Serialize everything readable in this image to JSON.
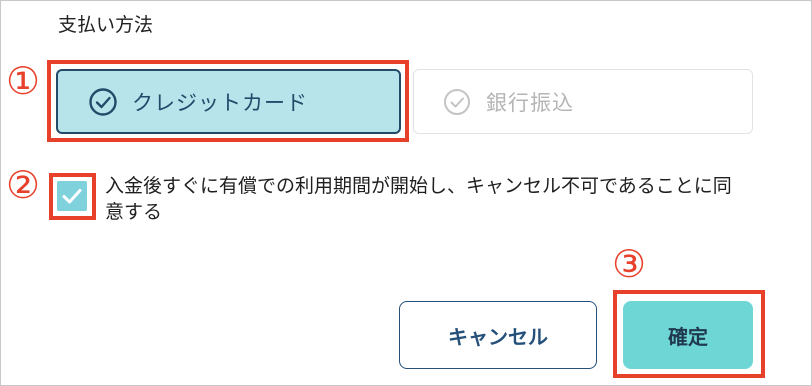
{
  "section_title": "支払い方法",
  "payment_options": [
    {
      "label": "クレジットカード",
      "icon": "check-circle-icon",
      "selected": true
    },
    {
      "label": "銀行振込",
      "icon": "check-circle-icon",
      "selected": false
    }
  ],
  "agreement": {
    "checked": true,
    "text": "入金後すぐに有償での利用期間が開始し、キャンセル不可であることに同意する"
  },
  "buttons": {
    "cancel_label": "キャンセル",
    "confirm_label": "確定"
  },
  "markers": [
    "①",
    "②",
    "③"
  ],
  "colors": {
    "annotation_red": "#e8412b",
    "selected_bg": "#b7e4ea",
    "selected_text": "#244a6a",
    "confirm_bg": "#6fd6d6",
    "checkbox_bg": "#7fd2dc"
  }
}
